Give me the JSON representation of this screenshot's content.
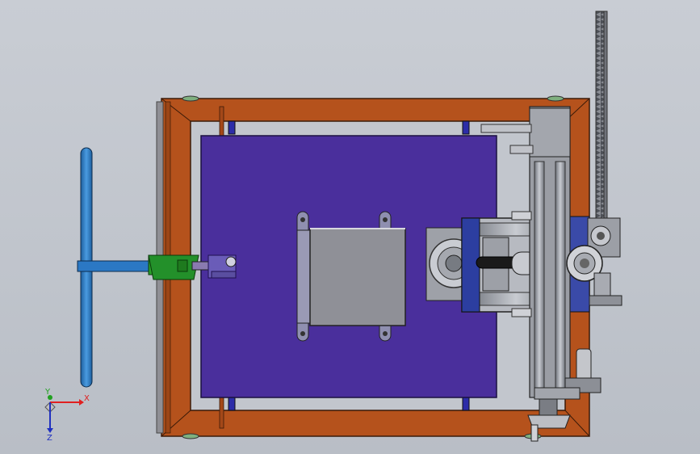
{
  "view": {
    "background_top": "#c9cdd4",
    "background_bottom": "#b9bec6"
  },
  "triad": {
    "x_label": "X",
    "y_label": "Y",
    "z_label": "Z",
    "x_color": "#e02020",
    "y_color": "#20a020",
    "z_color": "#2030c0"
  },
  "colors": {
    "frame": "#b5521c",
    "plate": "#4a2f9c",
    "handle": "#2b78c4",
    "bracket": "#2aa02a",
    "rail": "#8a8e96",
    "block": "#8f9097",
    "rack": "#7d8087"
  },
  "components": [
    "frame",
    "base-plate",
    "handwheel-bar",
    "clamp-bracket",
    "center-block",
    "slide-rail",
    "rack",
    "gearbox",
    "motor",
    "spindle"
  ]
}
